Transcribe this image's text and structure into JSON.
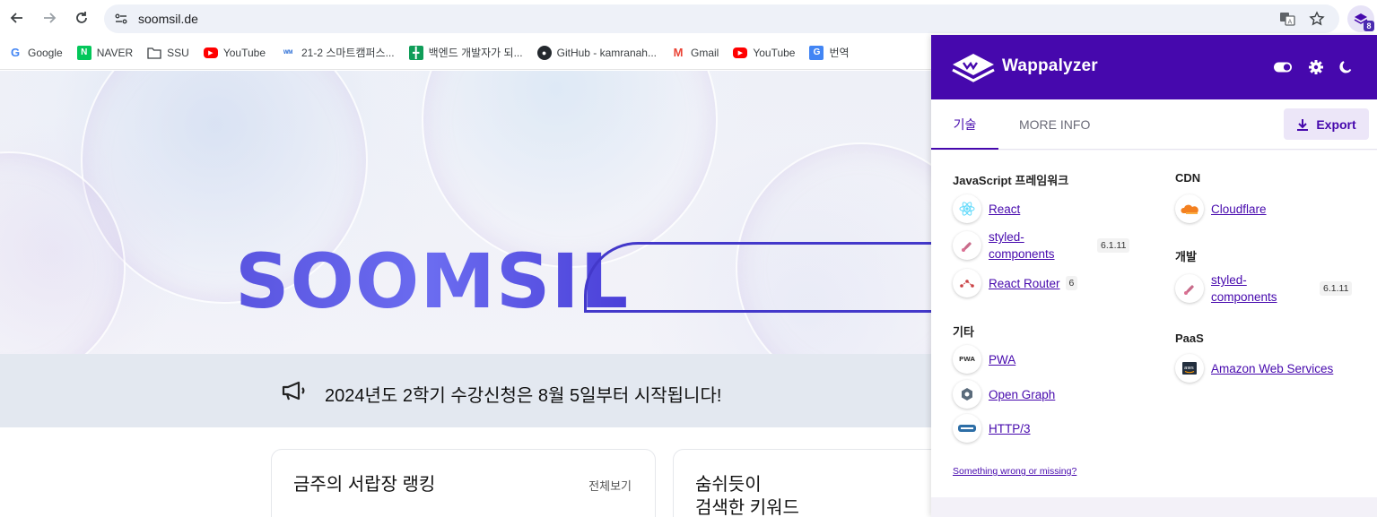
{
  "browser": {
    "url": "soomsil.de",
    "extension_badge": "8",
    "bookmarks": [
      {
        "label": "Google",
        "icon": "google-icon"
      },
      {
        "label": "NAVER",
        "icon": "naver-icon"
      },
      {
        "label": "SSU",
        "icon": "folder-icon"
      },
      {
        "label": "YouTube",
        "icon": "youtube-icon"
      },
      {
        "label": "21-2 스마트캠퍼스...",
        "icon": "smart-campus-icon"
      },
      {
        "label": "백엔드 개발자가 되...",
        "icon": "sheet-icon"
      },
      {
        "label": "GitHub - kamranah...",
        "icon": "github-icon"
      },
      {
        "label": "Gmail",
        "icon": "gmail-icon"
      },
      {
        "label": "YouTube",
        "icon": "youtube-icon"
      },
      {
        "label": "번역",
        "icon": "translate-icon"
      }
    ]
  },
  "page": {
    "logo": "SOOMSIL",
    "notice": "2024년도 2학기 수강신청은 8월 5일부터 시작됩니다!",
    "cards": [
      {
        "title": "금주의 서랍장 랭킹",
        "more": "전체보기"
      },
      {
        "title_line1": "숨쉬듯이",
        "title_line2": "검색한 키워드"
      }
    ]
  },
  "wappalyzer": {
    "title": "Wappalyzer",
    "tabs": [
      "기술",
      "MORE INFO"
    ],
    "export_label": "Export",
    "left_column": [
      {
        "category": "JavaScript 프레임워크",
        "items": [
          {
            "name": "React",
            "version": ""
          },
          {
            "name_line1": "styled-",
            "name_line2": "components",
            "version": "6.1.11"
          },
          {
            "name": "React Router",
            "version": "6"
          }
        ]
      },
      {
        "category": "기타",
        "items": [
          {
            "name": "PWA",
            "version": ""
          },
          {
            "name": "Open Graph",
            "version": ""
          },
          {
            "name": "HTTP/3",
            "version": ""
          }
        ]
      }
    ],
    "right_column": [
      {
        "category": "CDN",
        "items": [
          {
            "name": "Cloudflare",
            "version": ""
          }
        ]
      },
      {
        "category": "개발",
        "items": [
          {
            "name_line1": "styled-",
            "name_line2": "components",
            "version": "6.1.11"
          }
        ]
      },
      {
        "category": "PaaS",
        "items": [
          {
            "name": "Amazon Web Services",
            "version": ""
          }
        ]
      }
    ],
    "feedback_link": "Something wrong or missing?"
  }
}
